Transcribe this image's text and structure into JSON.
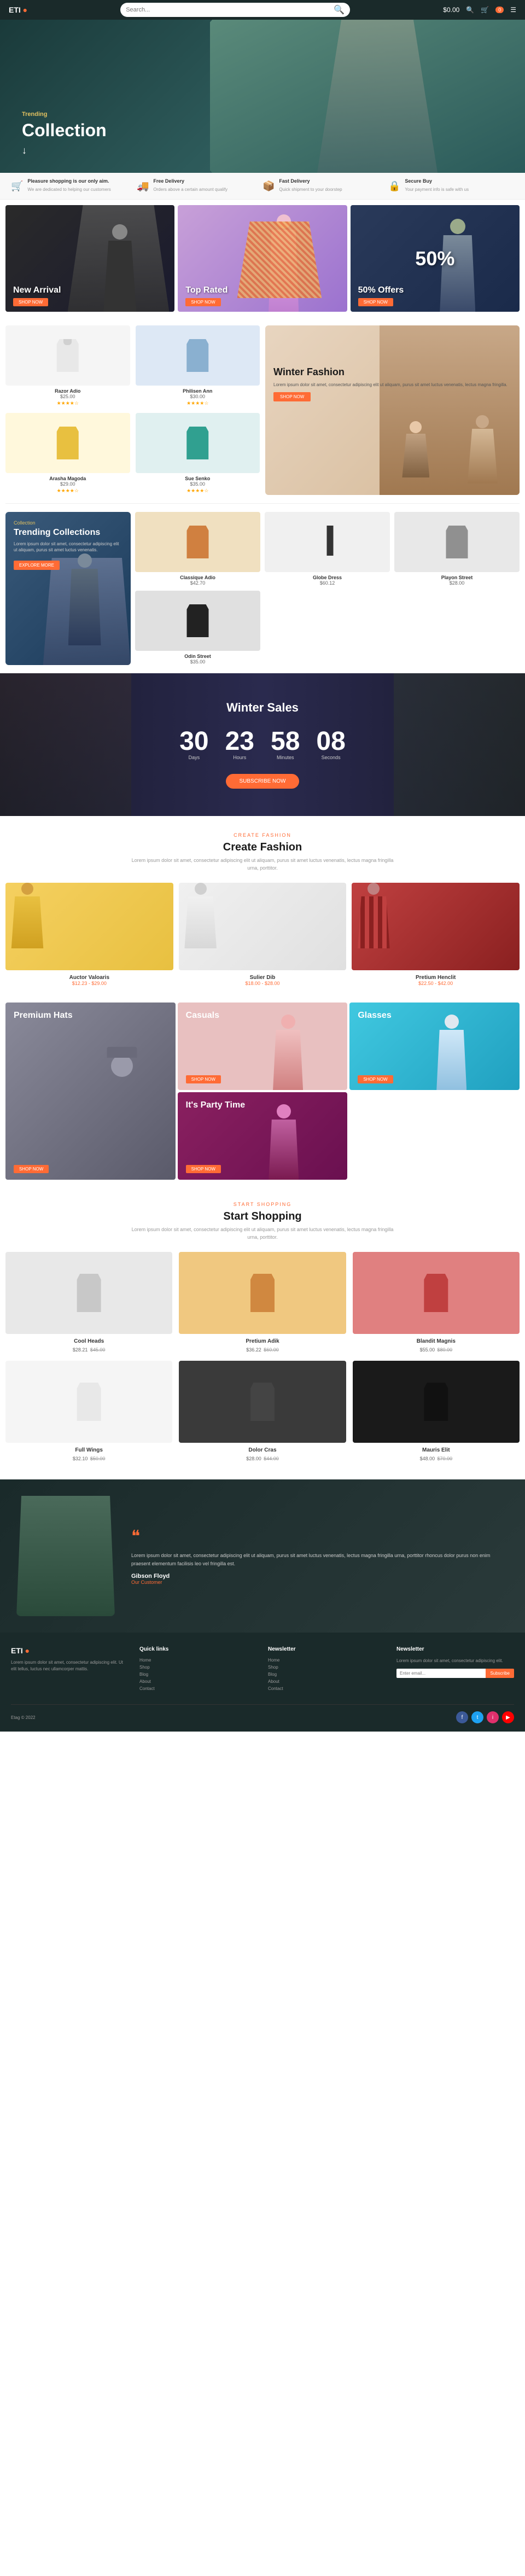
{
  "header": {
    "logo": "ETI",
    "logo_dot": "●",
    "cart_price": "$0.00",
    "search_placeholder": "Search..."
  },
  "hero": {
    "subtitle": "Trending",
    "title": "Collection",
    "scroll_icon": "↓"
  },
  "features": [
    {
      "icon": "🛒",
      "title": "Pleasure shopping is our only aim.",
      "subtitle": "We are dedicated to helping our customers"
    },
    {
      "icon": "🚚",
      "title": "Free Delivery",
      "subtitle": "Orders above a certain amount qualify"
    },
    {
      "icon": "📦",
      "title": "Fast Delivery",
      "subtitle": "Quick shipment to your doorstep"
    },
    {
      "icon": "🔒",
      "title": "Secure Buy",
      "subtitle": "Your payment info is safe with us"
    }
  ],
  "promo_cards": [
    {
      "label": "New Arrival",
      "btn": "SHOP NOW",
      "type": "new"
    },
    {
      "label": "Top Rated",
      "btn": "SHOP NOW",
      "type": "top"
    },
    {
      "label": "50% Offers",
      "btn": "SHOP NOW",
      "type": "offers"
    }
  ],
  "products_row1": [
    {
      "name": "Razor Adio",
      "price": "$25.00",
      "rating": "★★★★☆",
      "color": "white"
    },
    {
      "name": "Philisen Ann",
      "price": "$30.00",
      "rating": "★★★★☆",
      "color": "blue"
    }
  ],
  "products_row2": [
    {
      "name": "Arasha Magoda",
      "price": "$29.00",
      "rating": "★★★★☆",
      "color": "yellow"
    },
    {
      "name": "Sue Senko",
      "price": "$35.00",
      "rating": "★★★★☆",
      "color": "teal"
    }
  ],
  "winter_fashion": {
    "title": "Winter Fashion",
    "desc": "Lorem ipsum dolor sit amet, consectetur adipiscing elit ut aliquam, purus sit amet luctus venenatis, lectus magna fringilla.",
    "btn": "SHOP NOW"
  },
  "trending": {
    "subtitle": "Collection",
    "title": "Trending Collections",
    "desc": "Lorem ipsum dolor sit amet, consectetur adipiscing elit ut aliquam, purus sit amet luctus venenatis.",
    "btn": "EXPLORE MORE"
  },
  "trending_products": [
    {
      "name": "Classique Adio",
      "price": "$42.70",
      "color": "orange"
    },
    {
      "name": "Globe Dress",
      "price": "$60.12",
      "color": "white"
    },
    {
      "name": "Playon Street",
      "price": "$28.00",
      "color": "gray"
    },
    {
      "name": "Odin Street",
      "price": "$35.00",
      "color": "black"
    }
  ],
  "countdown": {
    "title": "Winter Sales",
    "days": "30",
    "hours": "23",
    "minutes": "58",
    "seconds": "08",
    "days_lbl": "Days",
    "hours_lbl": "Hours",
    "min_lbl": "Minutes",
    "sec_lbl": "Seconds",
    "btn": "SUBSCRIBE NOW"
  },
  "create_fashion": {
    "subtitle": "Create Fashion",
    "title": "Create Fashion",
    "desc": "Lorem ipsum dolor sit amet, consectetur adipiscing elit ut aliquam, purus sit amet luctus venenatis, lectus magna fringilla urna, porttitor."
  },
  "fashion_products": [
    {
      "name": "Auctor Valoaris",
      "price": "$12.23 - $29.00",
      "color": "yellow"
    },
    {
      "name": "Sulier Dib",
      "price": "$18.00 - $28.00",
      "color": "white"
    },
    {
      "name": "Pretium Henclit",
      "price": "$22.50 - $42.00",
      "color": "plaid"
    }
  ],
  "promo_categories": [
    {
      "label": "Premium Hats",
      "btn": "SHOP NOW",
      "type": "premium"
    },
    {
      "label": "Casuals",
      "btn": "SHOP NOW",
      "type": "casuals"
    },
    {
      "label": "Glasses",
      "btn": "SHOP NOW",
      "type": "glasses"
    },
    {
      "label": "It's Party Time",
      "btn": "SHOP NOW",
      "type": "party"
    }
  ],
  "start_shopping": {
    "subtitle": "Start Shopping",
    "title": "Start Shopping",
    "desc": "Lorem ipsum dolor sit amet, consectetur adipiscing elit ut aliquam, purus sit amet luctus venenatis, lectus magna fringilla urna, porttitor."
  },
  "shop_products": [
    {
      "name": "Cool Heads",
      "price": "$28.21",
      "old_price": "$45.00",
      "color": "gray"
    },
    {
      "name": "Pretium Adik",
      "price": "$36.22",
      "old_price": "$60.00",
      "color": "orange"
    },
    {
      "name": "Blandit Magnis",
      "price": "$55.00",
      "old_price": "$80.00",
      "color": "red"
    },
    {
      "name": "Full Wings",
      "price": "$32.10",
      "old_price": "$50.00",
      "color": "white"
    },
    {
      "name": "Dolor Cras",
      "price": "$28.00",
      "old_price": "$44.00",
      "color": "dark"
    },
    {
      "name": "Mauris Elit",
      "price": "$48.00",
      "old_price": "$70.00",
      "color": "black"
    }
  ],
  "testimonial": {
    "icon": "❝",
    "text": "Lorem ipsum dolor sit amet, consectetur adipiscing elit ut aliquam, purus sit amet luctus venenatis, lectus magna fringilla urna, porttitor rhoncus dolor purus non enim praesent elementum facilisis leo vel fringilla est.",
    "name": "Gibson Floyd",
    "role": "Our Customer"
  },
  "footer": {
    "logo": "ETI",
    "col1_title": "ETI ●",
    "col1_text": "Lorem ipsum dolor sit amet, consectetur adipiscing elit. Ut elit tellus, luctus nec ullamcorper mattis.",
    "col2_title": "Quick links",
    "col2_links": [
      "Home",
      "Shop",
      "Blog",
      "About",
      "Contact"
    ],
    "col3_title": "Newsletter",
    "col3_links": [
      "Home",
      "Shop",
      "Blog",
      "About",
      "Contact"
    ],
    "col4_title": "Newsletter",
    "col4_text": "Lorem ipsum dolor sit amet, consectetur adipiscing elit.",
    "copyright": "Etag © 2022"
  }
}
